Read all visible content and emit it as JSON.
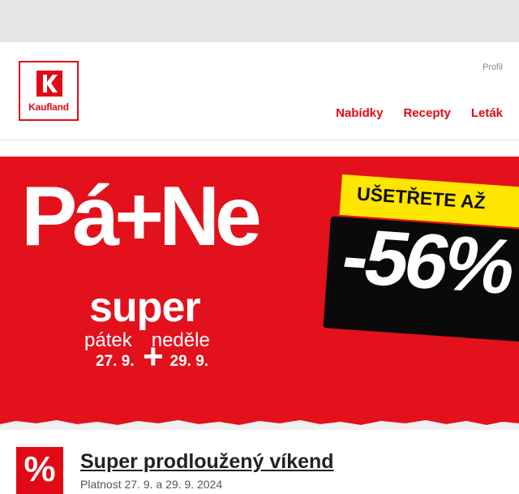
{
  "header": {
    "logo_text": "Kaufland",
    "profile_label": "Profil",
    "nav": [
      {
        "label": "Nabídky"
      },
      {
        "label": "Recepty"
      },
      {
        "label": "Leták"
      }
    ]
  },
  "banner": {
    "headline": "Pá+Ne",
    "sub": "super",
    "day1": "pátek",
    "day2": "neděle",
    "date1": "27. 9.",
    "date2": "29. 9.",
    "plus": "+",
    "save_label": "UŠETŘETE AŽ",
    "discount": "-56%",
    "colors": {
      "red": "#e3111c",
      "yellow": "#ffe600",
      "black": "#0a0a0a"
    }
  },
  "offer": {
    "icon": "percent-icon",
    "title": "Super prodloužený víkend",
    "validity": "Platnost 27. 9. a 29. 9. 2024"
  }
}
